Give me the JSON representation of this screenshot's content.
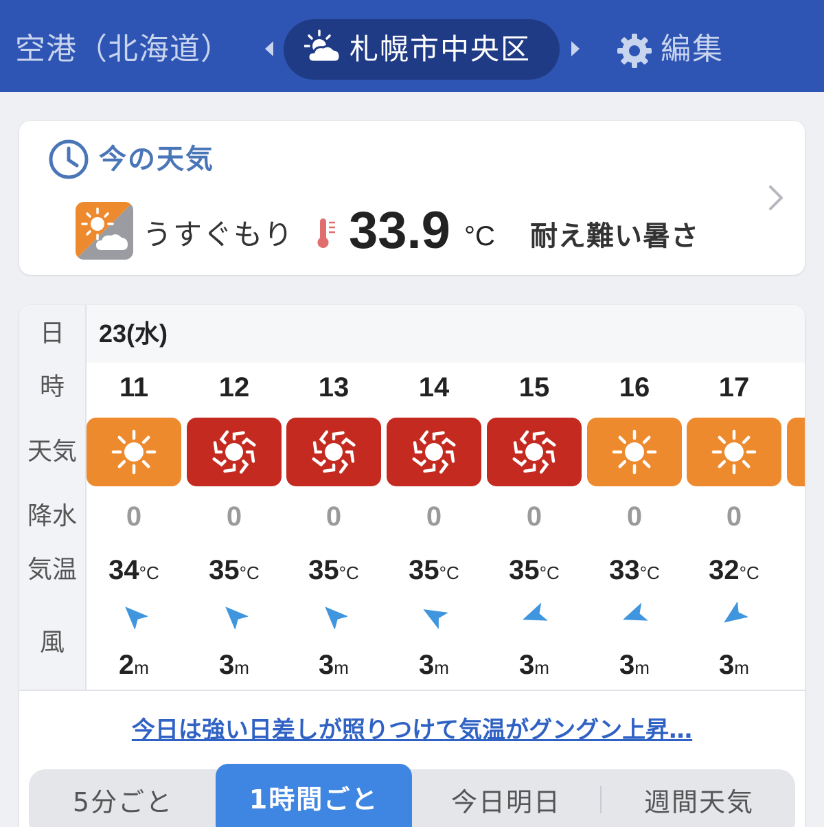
{
  "header": {
    "prev_location": "空港（北海道）",
    "current_location": "札幌市中央区",
    "edit_label": "編集",
    "colors": {
      "bar": "#2e55b3",
      "pill": "#1f3b85"
    }
  },
  "current_weather": {
    "title": "今の天気",
    "condition": "うすぐもり",
    "condition_icon": "sun-behind-cloud-icon",
    "temperature": "33.9",
    "temperature_unit": "°C",
    "heat_message": "耐え難い暑さ"
  },
  "hourly": {
    "labels": {
      "day": "日",
      "hour": "時",
      "weather": "天気",
      "precip": "降水",
      "temp": "気温",
      "wind": "風"
    },
    "date": "23(水)",
    "hours": [
      {
        "hour": "11",
        "weather": "sunny",
        "precip": "0",
        "temp": "34",
        "wind_speed": "2",
        "wind_dir_deg": 135
      },
      {
        "hour": "12",
        "weather": "extreme-sun",
        "precip": "0",
        "temp": "35",
        "wind_speed": "3",
        "wind_dir_deg": 135
      },
      {
        "hour": "13",
        "weather": "extreme-sun",
        "precip": "0",
        "temp": "35",
        "wind_speed": "3",
        "wind_dir_deg": 135
      },
      {
        "hour": "14",
        "weather": "extreme-sun",
        "precip": "0",
        "temp": "35",
        "wind_speed": "3",
        "wind_dir_deg": 120
      },
      {
        "hour": "15",
        "weather": "extreme-sun",
        "precip": "0",
        "temp": "35",
        "wind_speed": "3",
        "wind_dir_deg": 70
      },
      {
        "hour": "16",
        "weather": "sunny",
        "precip": "0",
        "temp": "33",
        "wind_speed": "3",
        "wind_dir_deg": 70
      },
      {
        "hour": "17",
        "weather": "sunny",
        "precip": "0",
        "temp": "32",
        "wind_speed": "3",
        "wind_dir_deg": 55
      }
    ],
    "temp_unit": "°C",
    "wind_unit": "m",
    "tile_colors": {
      "sunny": "#ee8a2e",
      "extreme-sun": "#c42a1f"
    },
    "wind_arrow_color": "#3f95de"
  },
  "news_link": "今日は強い日差しが照りつけて気温がグングン上昇…",
  "tabs": [
    {
      "label": "5分ごと",
      "active": false
    },
    {
      "label": "1時間ごと",
      "active": true
    },
    {
      "label": "今日明日",
      "active": false
    },
    {
      "label": "週間天気",
      "active": false
    }
  ]
}
